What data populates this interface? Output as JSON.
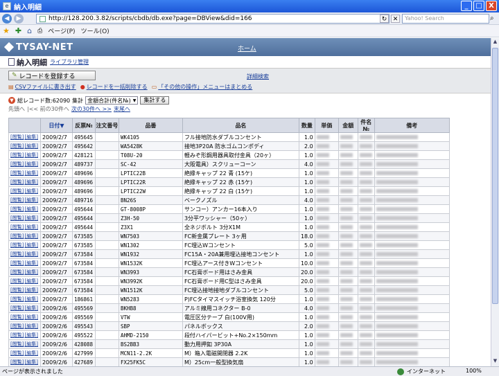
{
  "window": {
    "title": "納入明細",
    "min": "_",
    "max": "□",
    "close": "X"
  },
  "address": {
    "url": "http://128.200.3.82/scripts/cbdb/db.exe?page=DBView&did=166",
    "search_placeholder": "Yahoo! Search"
  },
  "toolbar": {
    "page_label": "ページ(P)",
    "tools_label": "ツール(O)"
  },
  "header": {
    "brand": "TYSAY-NET",
    "home_link": "ホーム"
  },
  "subhead": {
    "title": "納入明細",
    "library_link": "ライブラリ管理"
  },
  "actions": {
    "register": "レコードを登録する",
    "detail_search": "詳細検索",
    "csv": "CSVファイルに書き出す",
    "bulk_delete": "レコードを一括削除する",
    "other_ops": "「その他の操作」メニューはまとめる"
  },
  "filter": {
    "total_label": "総レコード数:62090",
    "agg_label": "集計",
    "agg_select": "金額合計(件名№)",
    "agg_button": "集計する"
  },
  "pager": {
    "first": "先頭へ",
    "prev": "|<< 前の30件へ",
    "next": "次の30件へ >>",
    "last": "末尾へ"
  },
  "table": {
    "headers": [
      "",
      "日付▼",
      "反票№",
      "注文番号",
      "品番",
      "品名",
      "数量",
      "単価",
      "金額",
      "件名№",
      "備考"
    ],
    "edit_label": "[閲覧]",
    "edit_label2": "[編集]",
    "rows": [
      [
        "2009/2/7",
        "495645",
        "",
        "WK4105",
        "フル接地防水ダブルコンセント",
        "1.0"
      ],
      [
        "2009/2/7",
        "495642",
        "",
        "WA5428K",
        "接地3P20A 防水ゴムコンポディ",
        "2.0"
      ],
      [
        "2009/2/7",
        "428121",
        "",
        "T08U-20",
        "軽みぞ形鋼用器具取付金具（20ヶ）",
        "1.0"
      ],
      [
        "2009/2/7",
        "489737",
        "",
        "SC-42",
        "大阪電具）スクリューコーン",
        "4.0"
      ],
      [
        "2009/2/7",
        "489696",
        "",
        "LPTIC22B",
        "絶縁キャップ 22 青 (15ケ)",
        "1.0"
      ],
      [
        "2009/2/7",
        "489696",
        "",
        "LPTIC22R",
        "絶縁キャップ 22 赤 (15ケ)",
        "1.0"
      ],
      [
        "2009/2/7",
        "489696",
        "",
        "LPTIC22W",
        "絶縁キャップ 22 白 (15ケ)",
        "1.0"
      ],
      [
        "2009/2/7",
        "489716",
        "",
        "BN26S",
        "ベークノズル",
        "4.0"
      ],
      [
        "2009/2/7",
        "495644",
        "",
        "GT-8008P",
        "サンコー）アンカー16本入り",
        "1.0"
      ],
      [
        "2009/2/7",
        "495644",
        "",
        "Z3H-50",
        "3分平ワッシャー（50ヶ）",
        "1.0"
      ],
      [
        "2009/2/7",
        "495644",
        "",
        "Z3X1",
        "全ネジボルト 3分X1M",
        "1.0"
      ],
      [
        "2009/2/7",
        "673585",
        "",
        "WN7503",
        "FC新金属プレート 3ヶ用",
        "18.0"
      ],
      [
        "2009/2/7",
        "673585",
        "",
        "WN1302",
        "FC埋込Wコンセント",
        "5.0"
      ],
      [
        "2009/2/7",
        "673584",
        "",
        "WN1932",
        "FC15A・20A兼用埋込接地コンセント",
        "1.0"
      ],
      [
        "2009/2/7",
        "673584",
        "",
        "WN1532K",
        "FC埋込アース付きWコンセント",
        "10.0"
      ],
      [
        "2009/2/7",
        "673584",
        "",
        "WN3993",
        "FC石膏ボード用はさみ金具",
        "20.0"
      ],
      [
        "2009/2/7",
        "673584",
        "",
        "WN3992K",
        "FC石膏ボード用C型はさみ金具",
        "20.0"
      ],
      [
        "2009/2/7",
        "673584",
        "",
        "WN1512K",
        "FC埋込接地接地ダブルコンセント",
        "5.0"
      ],
      [
        "2009/2/7",
        "186861",
        "",
        "WN5283",
        "P)FCタイマスイッチ浴室換気 120分",
        "1.0"
      ],
      [
        "2009/2/6",
        "495569",
        "",
        "BKHB8",
        "アルミ線用コネクター B-0",
        "4.0"
      ],
      [
        "2009/2/6",
        "495569",
        "",
        "VTW",
        "電圧区分テープ 白(100V用)",
        "1.0"
      ],
      [
        "2009/2/6",
        "495543",
        "",
        "SBP",
        "パネルボックス",
        "2.0"
      ],
      [
        "2009/2/6",
        "495522",
        "",
        "AHMD-2150",
        "段付ハイパービット+No.2×150mm",
        "1.0"
      ],
      [
        "2009/2/6",
        "428088",
        "",
        "BS2BB3",
        "動力用押釦 3P30A",
        "1.0"
      ],
      [
        "2009/2/6",
        "427999",
        "",
        "MCN11-2.2K",
        "M）箱入電磁開閉器 2.2K",
        "1.0"
      ],
      [
        "2009/2/6",
        "427689",
        "",
        "FX25FK5C",
        "M）25cm一般型換気扇",
        "1.0"
      ]
    ]
  },
  "status": {
    "text": "ページが表示されました",
    "zone": "インターネット",
    "zoom": "100%"
  }
}
